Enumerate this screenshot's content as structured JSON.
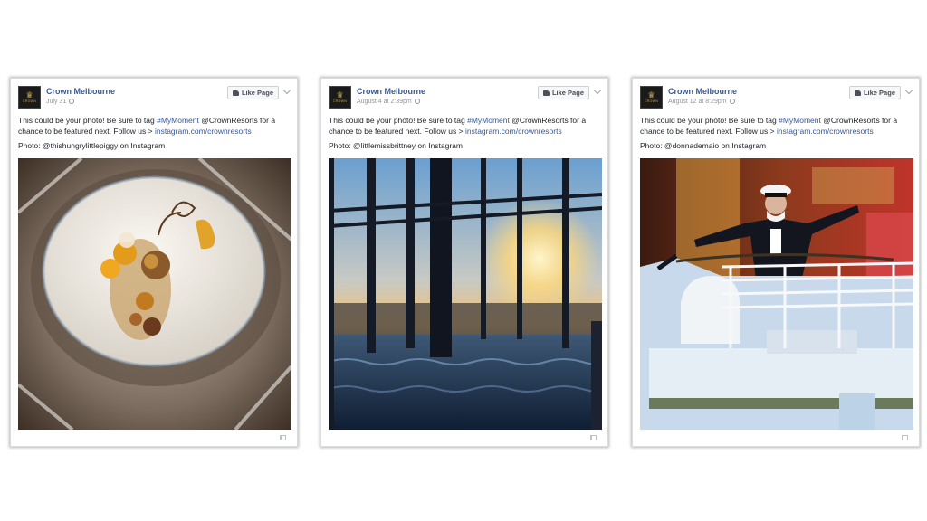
{
  "posts": [
    {
      "page_name": "Crown Melbourne",
      "timestamp": "July 31",
      "like_label": "Like Page",
      "text_before_tag": "This could be your photo! Be sure to tag ",
      "hashtag": "#MyMoment",
      "text_after_tag": " @CrownResorts for a chance to be featured next. Follow us > ",
      "link": "instagram.com/crownresorts",
      "photo_credit": "Photo: @thishungrylittlepiggy on Instagram",
      "image": "dessert-plate"
    },
    {
      "page_name": "Crown Melbourne",
      "timestamp": "August 4 at 2:39pm",
      "like_label": "Like Page",
      "text_before_tag": "This could be your photo! Be sure to tag ",
      "hashtag": "#MyMoment",
      "text_after_tag": " @CrownResorts for a chance to be featured next. Follow us > ",
      "link": "instagram.com/crownresorts",
      "photo_credit": "Photo: @littlemissbrittney on Instagram",
      "image": "sunset-infinity-pool"
    },
    {
      "page_name": "Crown Melbourne",
      "timestamp": "August 12 at 8:29pm",
      "like_label": "Like Page",
      "text_before_tag": "This could be your photo! Be sure to tag ",
      "hashtag": "#MyMoment",
      "text_after_tag": " @CrownResorts for a chance to be featured next. Follow us > ",
      "link": "instagram.com/crownresorts",
      "photo_credit": "Photo: @donnademaio on Instagram",
      "image": "captain-on-ship"
    }
  ],
  "logo": {
    "wordmark": "CROWN",
    "crown_glyph": "♛"
  },
  "colors": {
    "page_name": "#3b5998",
    "link": "#365899",
    "meta": "#90949c"
  }
}
